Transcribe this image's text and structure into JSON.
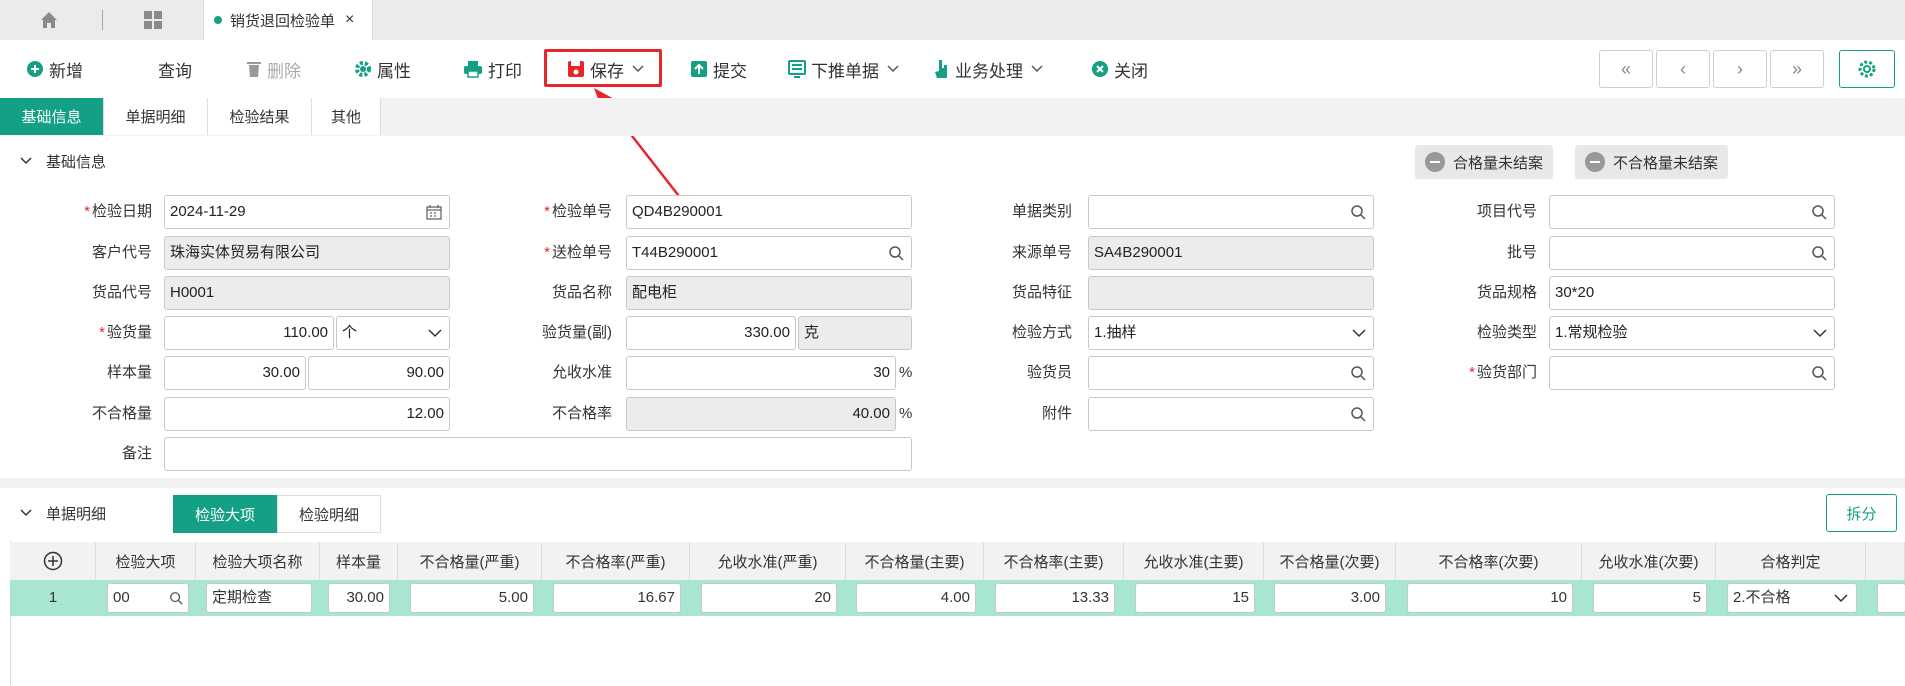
{
  "doc_tab": {
    "title": "销货退回检验单",
    "close": "×"
  },
  "toolbar": {
    "new": "新增",
    "query": "查询",
    "delete": "删除",
    "properties": "属性",
    "print": "打印",
    "save": "保存",
    "submit": "提交",
    "push_down": "下推单据",
    "business": "业务处理",
    "close": "关闭"
  },
  "nav": {
    "first": "«",
    "prev": "‹",
    "next": "›",
    "last": "»"
  },
  "section_tabs": [
    "基础信息",
    "单据明细",
    "检验结果",
    "其他"
  ],
  "basic": {
    "title": "基础信息",
    "badge_pass": "合格量未结案",
    "badge_fail": "不合格量未结案"
  },
  "form": {
    "inspect_date_label": "检验日期",
    "inspect_date": "2024-11-29",
    "inspect_no_label": "检验单号",
    "inspect_no": "QD4B290001",
    "doc_type_label": "单据类别",
    "doc_type": "",
    "project_label": "项目代号",
    "project": "",
    "customer_label": "客户代号",
    "customer": "珠海实体贸易有限公司",
    "send_no_label": "送检单号",
    "send_no": "T44B290001",
    "source_no_label": "来源单号",
    "source_no": "SA4B290001",
    "batch_label": "批号",
    "batch": "",
    "goods_code_label": "货品代号",
    "goods_code": "H0001",
    "goods_name_label": "货品名称",
    "goods_name": "配电柜",
    "goods_feature_label": "货品特征",
    "goods_feature": "",
    "goods_spec_label": "货品规格",
    "goods_spec": "30*20",
    "qty_label": "验货量",
    "qty": "110.00",
    "qty_unit": "个",
    "qty_sub_label": "验货量(副)",
    "qty_sub": "330.00",
    "qty_sub_unit": "克",
    "method_label": "检验方式",
    "method": "1.抽样",
    "type_label": "检验类型",
    "type": "1.常规检验",
    "sample_label": "样本量",
    "sample1": "30.00",
    "sample2": "90.00",
    "aql_label": "允收水准",
    "aql": "30",
    "aql_unit": "%",
    "inspector_label": "验货员",
    "inspector": "",
    "dept_label": "验货部门",
    "dept": "",
    "fail_qty_label": "不合格量",
    "fail_qty": "12.00",
    "fail_rate_label": "不合格率",
    "fail_rate": "40.00",
    "fail_rate_unit": "%",
    "attach_label": "附件",
    "attach": "",
    "remark_label": "备注",
    "remark": ""
  },
  "detail": {
    "title": "单据明细",
    "tab_major": "检验大项",
    "tab_detail": "检验明细",
    "split": "拆分",
    "columns": [
      "检验大项",
      "检验大项名称",
      "样本量",
      "不合格量(严重)",
      "不合格率(严重)",
      "允收水准(严重)",
      "不合格量(主要)",
      "不合格率(主要)",
      "允收水准(主要)",
      "不合格量(次要)",
      "不合格率(次要)",
      "允收水准(次要)",
      "合格判定"
    ],
    "row": {
      "index": "1",
      "major": "00",
      "name": "定期检查",
      "sample": "30.00",
      "fq_s": "5.00",
      "fr_s": "16.67",
      "aql_s": "20",
      "fq_m": "4.00",
      "fr_m": "13.33",
      "aql_m": "15",
      "fq_n": "3.00",
      "fr_n": "10",
      "aql_n": "5",
      "judge": "2.不合格"
    }
  },
  "colors": {
    "accent": "#14a085",
    "highlight": "#e5262a",
    "row": "#a8e5d2"
  }
}
